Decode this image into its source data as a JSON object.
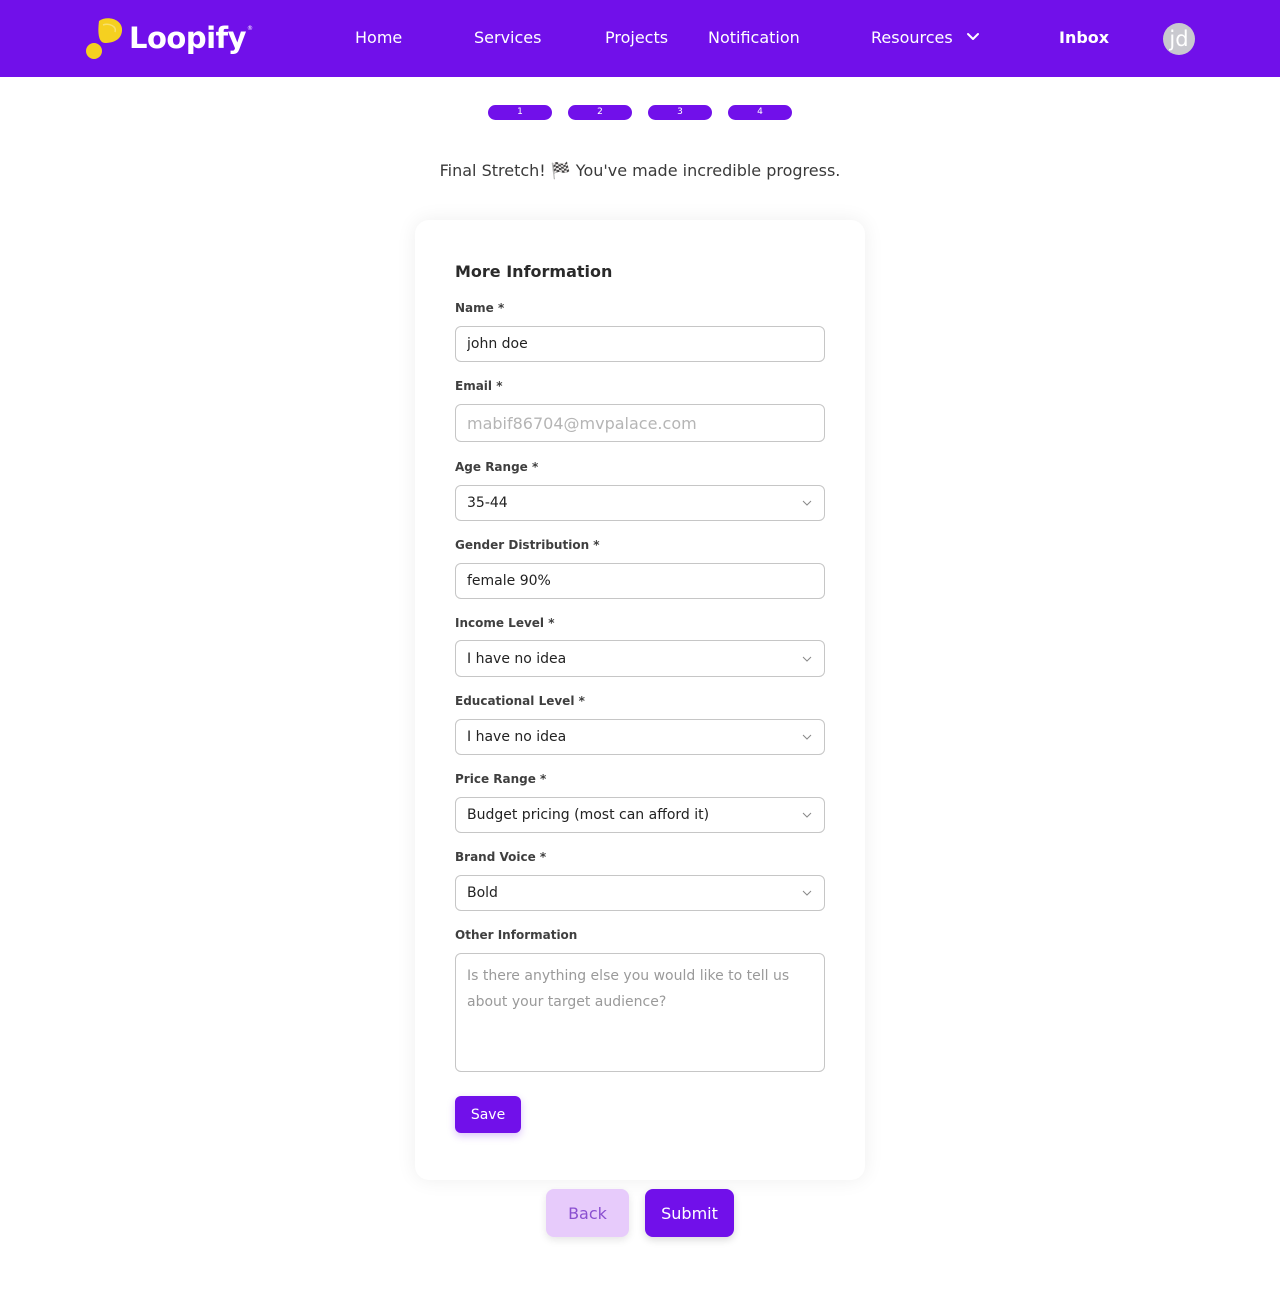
{
  "brand": {
    "name": "Loopify",
    "reg_mark": "®",
    "accent_color": "#7110ea",
    "logo_color": "#f5d020"
  },
  "nav": {
    "home": "Home",
    "services": "Services",
    "projects": "Projects",
    "notification": "Notification",
    "resources": "Resources",
    "inbox": "Inbox",
    "avatar_initials": "jd"
  },
  "steps": [
    "1",
    "2",
    "3",
    "4"
  ],
  "progress_message": "Final Stretch! 🏁 You've made incredible progress.",
  "form": {
    "title": "More Information",
    "name": {
      "label": "Name *",
      "value": "john doe"
    },
    "email": {
      "label": "Email *",
      "value": "mabif86704@mvpalace.com"
    },
    "age_range": {
      "label": "Age Range *",
      "value": "35-44"
    },
    "gender_distribution": {
      "label": "Gender Distribution *",
      "value": "female 90%"
    },
    "income_level": {
      "label": "Income Level *",
      "value": "I have no idea"
    },
    "educational_level": {
      "label": "Educational Level *",
      "value": "I have no idea"
    },
    "price_range": {
      "label": "Price Range *",
      "value": "Budget pricing (most can afford it)"
    },
    "brand_voice": {
      "label": "Brand Voice *",
      "value": "Bold"
    },
    "other_information": {
      "label": "Other Information",
      "placeholder": "Is there anything else you would like to tell us about your target audience?"
    },
    "save_label": "Save"
  },
  "actions": {
    "back_label": "Back",
    "submit_label": "Submit"
  }
}
